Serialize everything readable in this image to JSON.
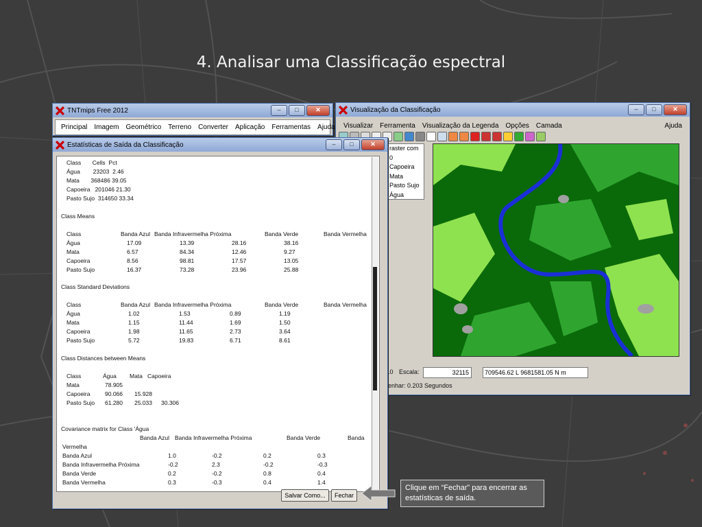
{
  "slide": {
    "title": "4. Analisar uma Classificação espectral",
    "callout": "Clique em “Fechar” para encerrar as estatísticas de saída."
  },
  "main_window": {
    "title": "TNTmips Free 2012",
    "menu": [
      "Principal",
      "Imagem",
      "Geométrico",
      "Terreno",
      "Converter",
      "Aplicação",
      "Ferramentas",
      "Ajuda"
    ]
  },
  "stats_window": {
    "title": "Estatísticas de Saída da Classificação",
    "counts_header": "Class       Cells  Pct",
    "counts_rows": [
      "Água        23203  2.46",
      "Mata       368486 39.05",
      "Capoeira   201046 21.30",
      "Pasto Sujo  314650 33.34"
    ],
    "means_title": "Class Means",
    "means_header": [
      "Class",
      "Banda Azul",
      "Banda Infravermelha Próxima",
      "Banda Verde",
      "Banda Vermelha"
    ],
    "means_rows": [
      [
        "Água",
        "17.09",
        "13.39",
        "28.16",
        "38.16"
      ],
      [
        "Mata",
        "6.57",
        "84.34",
        "12.46",
        "9.27"
      ],
      [
        "Capoeira",
        "8.56",
        "98.81",
        "17.57",
        "13.05"
      ],
      [
        "Pasto Sujo",
        "16.37",
        "73.28",
        "23.96",
        "25.88"
      ]
    ],
    "sd_title": "Class Standard Deviations",
    "sd_rows": [
      [
        "Água",
        "1.02",
        "1.53",
        "0.89",
        "1.19"
      ],
      [
        "Mata",
        "1.15",
        "11.44",
        "1.69",
        "1.50"
      ],
      [
        "Capoeira",
        "1.98",
        "11.65",
        "2.73",
        "3.64"
      ],
      [
        "Pasto Sujo",
        "5.72",
        "19.83",
        "6.71",
        "8.61"
      ]
    ],
    "dist_title": "Class Distances between Means",
    "dist_header": [
      "Class",
      "Água",
      "Mata",
      "Capoeira"
    ],
    "dist_rows": [
      [
        "Mata",
        "78.905",
        "",
        ""
      ],
      [
        "Capoeira",
        "90.066",
        "15.928",
        ""
      ],
      [
        "Pasto Sujo",
        "61.280",
        "25.033",
        "30.306"
      ]
    ],
    "cov_title": "Covariance matrix for Class 'Água",
    "cov_header": [
      "Banda Azul",
      "Banda Infravermelha Próxima",
      "Banda Verde",
      "Banda"
    ],
    "cov_header_wrap": "Vermelha",
    "cov_rows": [
      [
        "Banda Azul",
        "1.0",
        "-0.2",
        "0.2",
        "0.3"
      ],
      [
        "Banda Infravermelha Próxima",
        "-0.2",
        "2.3",
        "-0.2",
        "-0.3"
      ],
      [
        "Banda Verde",
        "0.2",
        "-0.2",
        "0.8",
        "0.4"
      ],
      [
        "Banda Vermelha",
        "0.3",
        "-0.3",
        "0.4",
        "1.4"
      ]
    ],
    "save_label": "Salvar Como...",
    "close_label": "Fechar"
  },
  "viz_window": {
    "title": "Visualização da Classificação",
    "menu": [
      "Visualizar",
      "Ferramenta",
      "Visualização da Legenda",
      "Opções",
      "Camada"
    ],
    "help": "Ajuda",
    "legend": [
      "raster com",
      "0",
      "Capoeira",
      "Mata",
      "Pasto Sujo",
      "Água"
    ],
    "scale_left": ".0",
    "scale_label": "Escala:",
    "scale_value": "32115",
    "coords": "709546.62 L  9681581.05 N m",
    "status": "enhar: 0.203 Segundos"
  },
  "colors": {
    "water": "#1a2fd6",
    "mata": "#0a6a0a",
    "capoeira": "#2fa52f",
    "pasto": "#8fe24f",
    "agua_bare": "#a0a0a0"
  }
}
